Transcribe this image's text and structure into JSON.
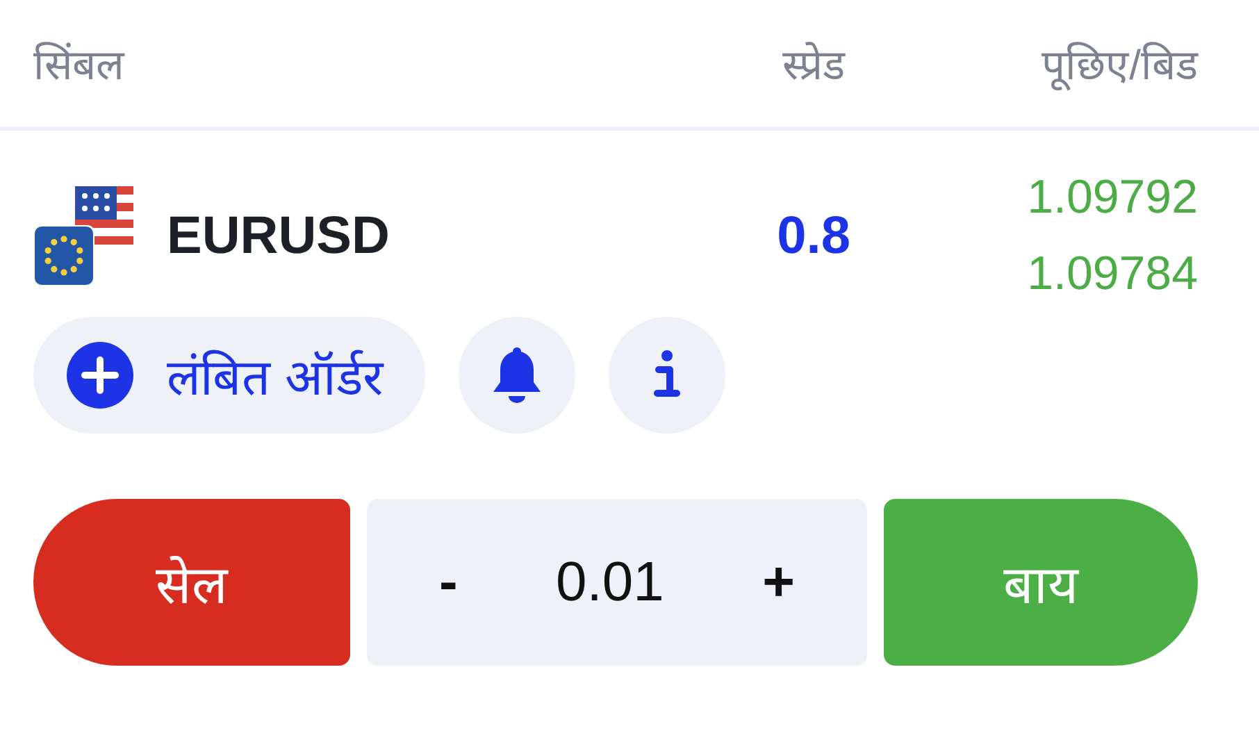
{
  "table": {
    "columns": [
      "सिंबल",
      "स्प्रेड",
      "पूछिए/बिड"
    ],
    "rows": [
      {
        "symbol": "EURUSD",
        "spread": "0.8",
        "ask": "1.09792",
        "bid": "1.09784"
      }
    ]
  },
  "actions": {
    "pending_order": "लंबित ऑर्डर"
  },
  "trade": {
    "sell": "सेल",
    "decrement": "-",
    "volume": "0.01",
    "increment": "+",
    "buy": "बाय"
  }
}
